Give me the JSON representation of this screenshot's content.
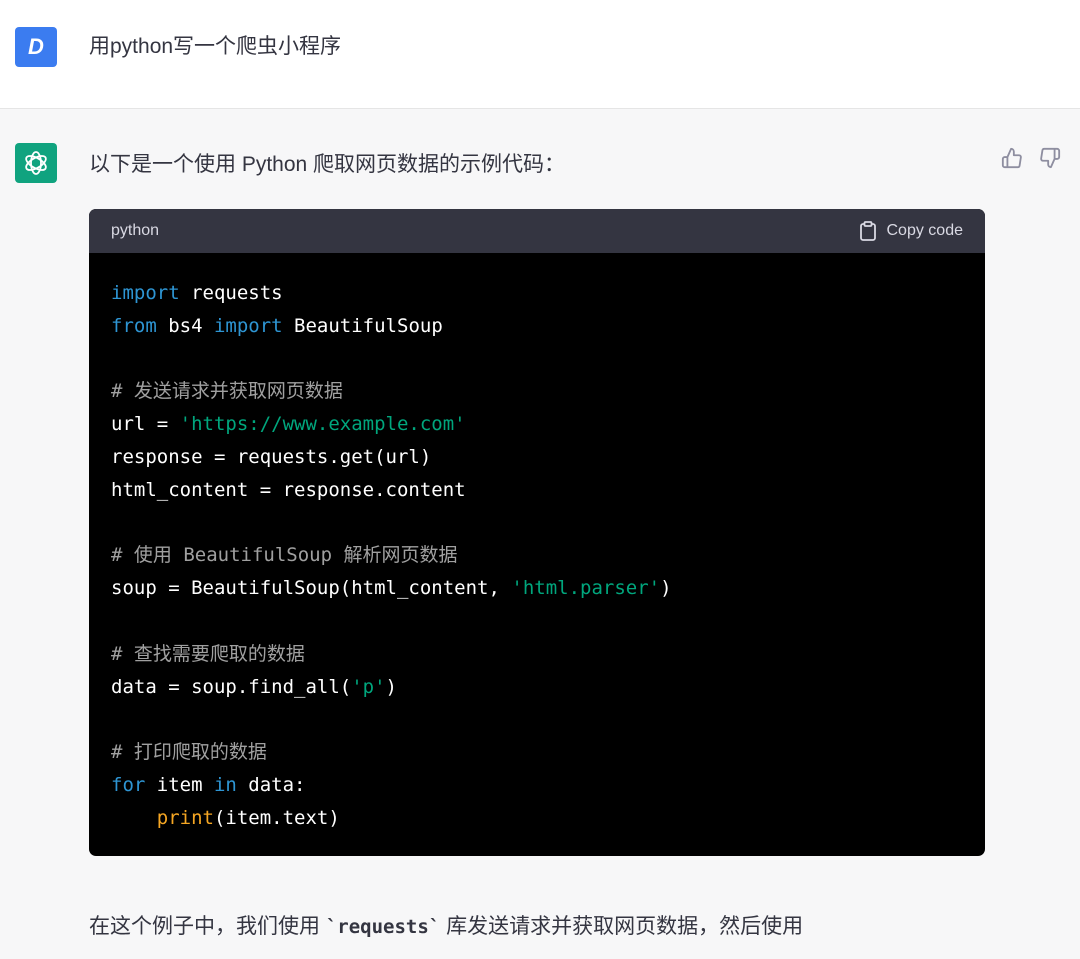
{
  "user_message": {
    "avatar_letter": "D",
    "text": "用python写一个爬虫小程序"
  },
  "assistant_message": {
    "intro": "以下是一个使用 Python 爬取网页数据的示例代码：",
    "code_block": {
      "language": "python",
      "copy_label": "Copy code",
      "lines": {
        "l1_kw": "import",
        "l1_rest": " requests",
        "l2_kw1": "from",
        "l2_mid": " bs4 ",
        "l2_kw2": "import",
        "l2_rest": " BeautifulSoup",
        "l4_cm": "# 发送请求并获取网页数据",
        "l5_pre": "url = ",
        "l5_str": "'https://www.example.com'",
        "l6": "response = requests.get(url)",
        "l7": "html_content = response.content",
        "l9_cm": "# 使用 BeautifulSoup 解析网页数据",
        "l10_pre": "soup = BeautifulSoup(html_content, ",
        "l10_str": "'html.parser'",
        "l10_post": ")",
        "l12_cm": "# 查找需要爬取的数据",
        "l13_pre": "data = soup.find_all(",
        "l13_str": "'p'",
        "l13_post": ")",
        "l15_cm": "# 打印爬取的数据",
        "l16_kw1": "for",
        "l16_mid": " item ",
        "l16_kw2": "in",
        "l16_rest": " data:",
        "l17_indent": "    ",
        "l17_fn": "print",
        "l17_rest": "(item.text)"
      }
    },
    "explanation": {
      "part1": "在这个例子中，我们使用 ",
      "code1": "`requests`",
      "part2": " 库发送请求并获取网页数据，然后使用"
    }
  },
  "colors": {
    "user_avatar": "#3b7cf0",
    "assistant_avatar": "#10a37f",
    "code_header": "#343541",
    "code_background": "#000000",
    "keyword": "#2e95d3",
    "string": "#00a67d",
    "comment": "#a0a0a0",
    "builtin": "#f5a623"
  },
  "icons": {
    "feedback_up": "thumbs-up-icon",
    "feedback_down": "thumbs-down-icon",
    "copy": "clipboard-icon",
    "assistant_avatar": "openai-logo-icon"
  }
}
